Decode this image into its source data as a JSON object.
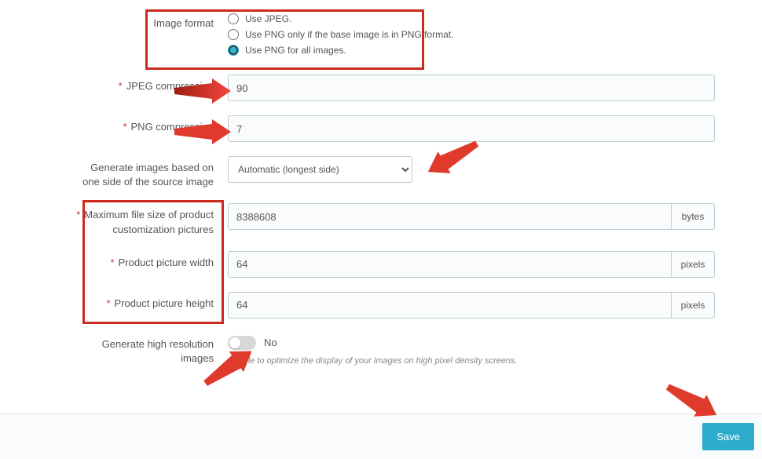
{
  "imageFormat": {
    "label": "Image format",
    "options": {
      "jpeg": "Use JPEG.",
      "pngIfBase": "Use PNG only if the base image is in PNG format.",
      "pngAll": "Use PNG for all images."
    },
    "selected": "pngAll"
  },
  "jpegCompression": {
    "label": "JPEG compression",
    "value": "90"
  },
  "pngCompression": {
    "label": "PNG compression",
    "value": "7"
  },
  "generateBased": {
    "label": "Generate images based on one side of the source image",
    "selected": "Automatic (longest side)"
  },
  "maxFileSize": {
    "label": "Maximum file size of product customization pictures",
    "value": "8388608",
    "unit": "bytes"
  },
  "productWidth": {
    "label": "Product picture width",
    "value": "64",
    "unit": "pixels"
  },
  "productHeight": {
    "label": "Product picture height",
    "value": "64",
    "unit": "pixels"
  },
  "highRes": {
    "label": "Generate high resolution images",
    "value": "No",
    "helper": "Enable to optimize the display of your images on high pixel density screens."
  },
  "saveButton": "Save"
}
